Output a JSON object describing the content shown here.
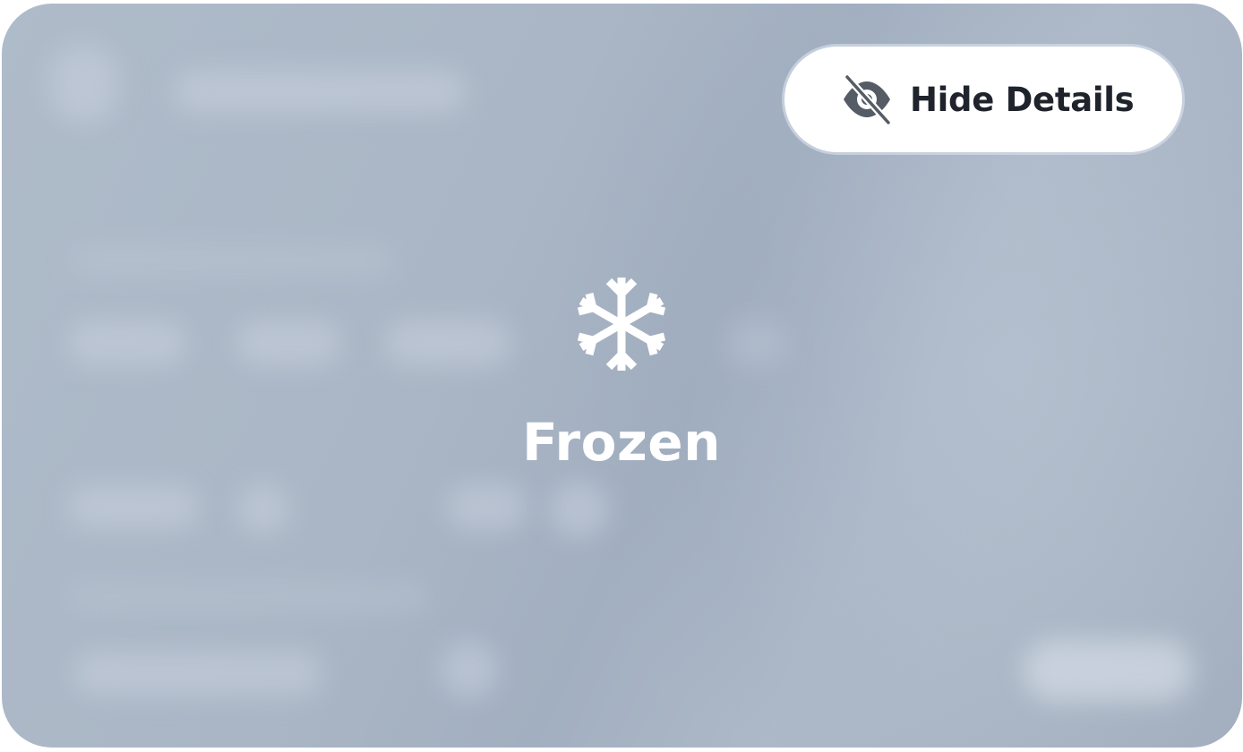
{
  "card": {
    "hide_details_label": "Hide Details",
    "hide_details_icon": "eye-slash-icon",
    "status_icon": "snowflake-icon",
    "status_label": "Frozen"
  },
  "colors": {
    "card_background": "#aab6c5",
    "button_background": "#ffffff",
    "button_text": "#1f232b",
    "icon_gray": "#555c66",
    "status_text": "#ffffff"
  }
}
